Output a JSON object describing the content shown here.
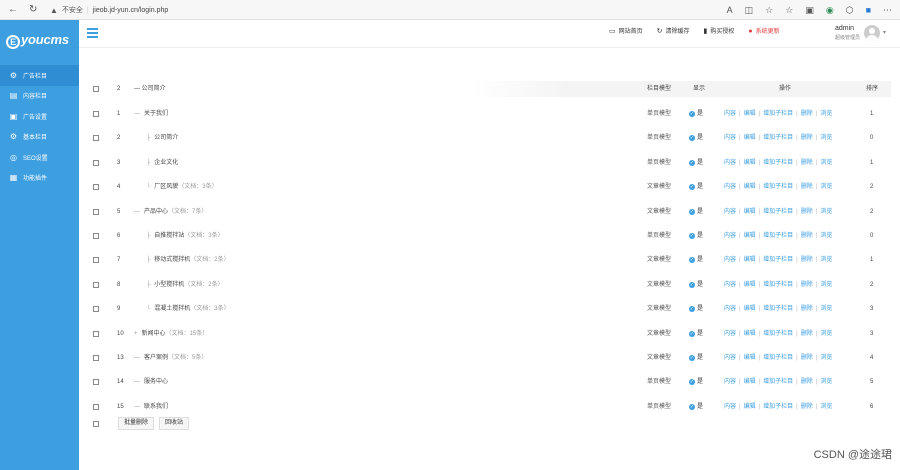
{
  "browser": {
    "security_label": "不安全",
    "url": "jieob.jd-yun.cn/login.php"
  },
  "sidebar": {
    "logo_letter": "E",
    "logo_text": "youcms",
    "items": [
      {
        "icon": "gear-icon",
        "label": "广告栏目"
      },
      {
        "icon": "document-icon",
        "label": "内容栏目"
      },
      {
        "icon": "image-icon",
        "label": "广告设置"
      },
      {
        "icon": "settings-icon",
        "label": "基本栏目"
      },
      {
        "icon": "seo-icon",
        "label": "SEO设置"
      },
      {
        "icon": "grid-icon",
        "label": "功能插件"
      }
    ]
  },
  "topbar": {
    "nav": [
      {
        "icon": "monitor-icon",
        "label": "网站首页"
      },
      {
        "icon": "refresh-icon",
        "label": "清除缓存"
      },
      {
        "icon": "bookmark-icon",
        "label": "购买授权"
      },
      {
        "icon": "alert-icon",
        "label": "系统更新"
      }
    ],
    "user": {
      "name": "admin",
      "role": "超级管理员"
    }
  },
  "table": {
    "header": {
      "num": "2",
      "name": "公司简介",
      "model": "栏目模型",
      "show": "显示",
      "ops": "操作",
      "sort": "排序"
    },
    "rows": [
      {
        "num": "1",
        "prefix": "—",
        "name": "关于我们",
        "meta": "",
        "model": "单页模型",
        "show": "是",
        "sort": "1",
        "indent": 0
      },
      {
        "num": "2",
        "prefix": "├",
        "name": "公司简介",
        "meta": "",
        "model": "单页模型",
        "show": "是",
        "sort": "0",
        "indent": 1
      },
      {
        "num": "3",
        "prefix": "├",
        "name": "企业文化",
        "meta": "",
        "model": "单页模型",
        "show": "是",
        "sort": "1",
        "indent": 1
      },
      {
        "num": "4",
        "prefix": "└",
        "name": "厂区风貌",
        "meta": "（文档：3条）",
        "model": "文章模型",
        "show": "是",
        "sort": "2",
        "indent": 1
      },
      {
        "num": "5",
        "prefix": "—",
        "name": "产品中心",
        "meta": "（文档：7条）",
        "model": "文章模型",
        "show": "是",
        "sort": "2",
        "indent": 0
      },
      {
        "num": "6",
        "prefix": "├",
        "name": "自推搅拌站",
        "meta": "（文档：3条）",
        "model": "单页模型",
        "show": "是",
        "sort": "0",
        "indent": 1
      },
      {
        "num": "7",
        "prefix": "├",
        "name": "移动式搅拌机",
        "meta": "（文档：2条）",
        "model": "文章模型",
        "show": "是",
        "sort": "1",
        "indent": 1
      },
      {
        "num": "8",
        "prefix": "├",
        "name": "小型搅拌机",
        "meta": "（文档：2条）",
        "model": "文章模型",
        "show": "是",
        "sort": "2",
        "indent": 1
      },
      {
        "num": "9",
        "prefix": "└",
        "name": "混凝土搅拌机",
        "meta": "（文档：3条）",
        "model": "文章模型",
        "show": "是",
        "sort": "3",
        "indent": 1
      },
      {
        "num": "10",
        "prefix": "+",
        "name": "新闻中心",
        "meta": "（文档：15条）",
        "model": "文章模型",
        "show": "是",
        "sort": "3",
        "indent": 0
      },
      {
        "num": "13",
        "prefix": "—",
        "name": "客户案例",
        "meta": "（文档：5条）",
        "model": "文章模型",
        "show": "是",
        "sort": "4",
        "indent": 0
      },
      {
        "num": "14",
        "prefix": "—",
        "name": "服务中心",
        "meta": "",
        "model": "单页模型",
        "show": "是",
        "sort": "5",
        "indent": 0
      },
      {
        "num": "15",
        "prefix": "—",
        "name": "联系我们",
        "meta": "",
        "model": "单页模型",
        "show": "是",
        "sort": "6",
        "indent": 0
      }
    ],
    "ops": [
      "内容",
      "编辑",
      "增加子栏目",
      "删除",
      "浏览"
    ]
  },
  "footer": {
    "batch_delete": "批量删除",
    "recycle": "回收站"
  },
  "watermark": "CSDN @途途珺"
}
